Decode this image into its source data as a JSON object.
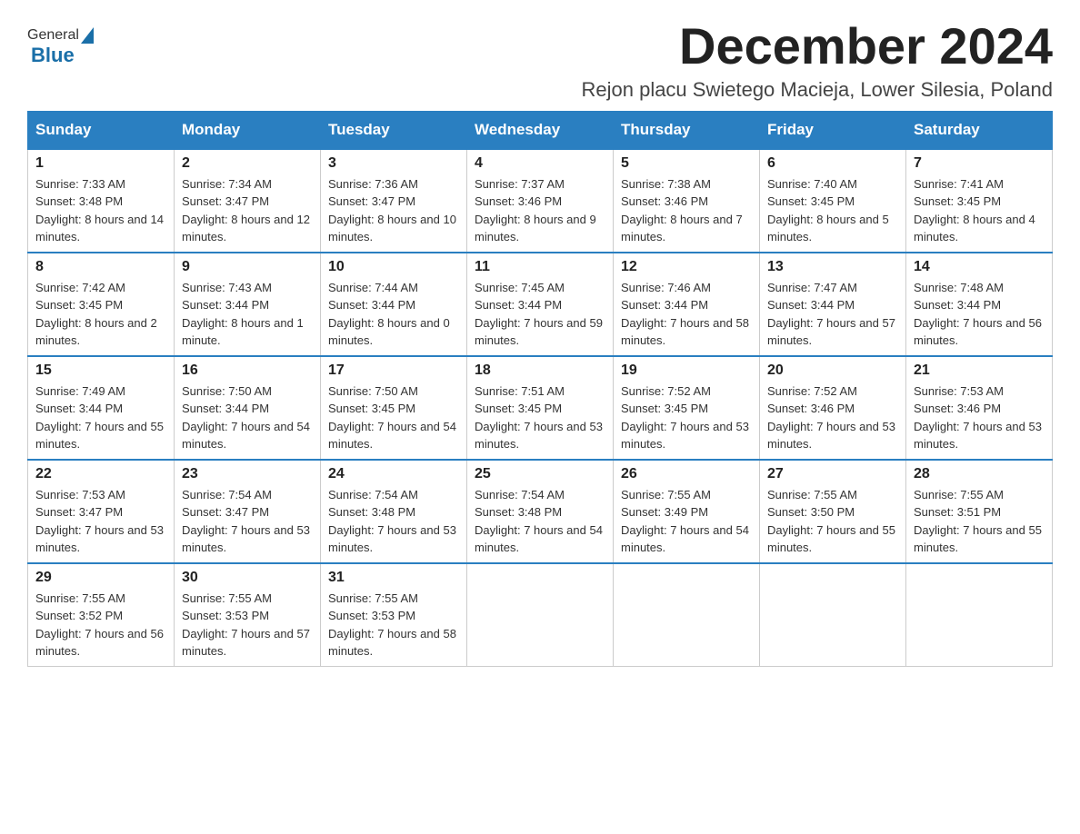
{
  "header": {
    "logo": {
      "general": "General",
      "blue": "Blue"
    },
    "title": "December 2024",
    "location": "Rejon placu Swietego Macieja, Lower Silesia, Poland"
  },
  "days_of_week": [
    "Sunday",
    "Monday",
    "Tuesday",
    "Wednesday",
    "Thursday",
    "Friday",
    "Saturday"
  ],
  "weeks": [
    [
      {
        "day": "1",
        "sunrise": "7:33 AM",
        "sunset": "3:48 PM",
        "daylight": "8 hours and 14 minutes."
      },
      {
        "day": "2",
        "sunrise": "7:34 AM",
        "sunset": "3:47 PM",
        "daylight": "8 hours and 12 minutes."
      },
      {
        "day": "3",
        "sunrise": "7:36 AM",
        "sunset": "3:47 PM",
        "daylight": "8 hours and 10 minutes."
      },
      {
        "day": "4",
        "sunrise": "7:37 AM",
        "sunset": "3:46 PM",
        "daylight": "8 hours and 9 minutes."
      },
      {
        "day": "5",
        "sunrise": "7:38 AM",
        "sunset": "3:46 PM",
        "daylight": "8 hours and 7 minutes."
      },
      {
        "day": "6",
        "sunrise": "7:40 AM",
        "sunset": "3:45 PM",
        "daylight": "8 hours and 5 minutes."
      },
      {
        "day": "7",
        "sunrise": "7:41 AM",
        "sunset": "3:45 PM",
        "daylight": "8 hours and 4 minutes."
      }
    ],
    [
      {
        "day": "8",
        "sunrise": "7:42 AM",
        "sunset": "3:45 PM",
        "daylight": "8 hours and 2 minutes."
      },
      {
        "day": "9",
        "sunrise": "7:43 AM",
        "sunset": "3:44 PM",
        "daylight": "8 hours and 1 minute."
      },
      {
        "day": "10",
        "sunrise": "7:44 AM",
        "sunset": "3:44 PM",
        "daylight": "8 hours and 0 minutes."
      },
      {
        "day": "11",
        "sunrise": "7:45 AM",
        "sunset": "3:44 PM",
        "daylight": "7 hours and 59 minutes."
      },
      {
        "day": "12",
        "sunrise": "7:46 AM",
        "sunset": "3:44 PM",
        "daylight": "7 hours and 58 minutes."
      },
      {
        "day": "13",
        "sunrise": "7:47 AM",
        "sunset": "3:44 PM",
        "daylight": "7 hours and 57 minutes."
      },
      {
        "day": "14",
        "sunrise": "7:48 AM",
        "sunset": "3:44 PM",
        "daylight": "7 hours and 56 minutes."
      }
    ],
    [
      {
        "day": "15",
        "sunrise": "7:49 AM",
        "sunset": "3:44 PM",
        "daylight": "7 hours and 55 minutes."
      },
      {
        "day": "16",
        "sunrise": "7:50 AM",
        "sunset": "3:44 PM",
        "daylight": "7 hours and 54 minutes."
      },
      {
        "day": "17",
        "sunrise": "7:50 AM",
        "sunset": "3:45 PM",
        "daylight": "7 hours and 54 minutes."
      },
      {
        "day": "18",
        "sunrise": "7:51 AM",
        "sunset": "3:45 PM",
        "daylight": "7 hours and 53 minutes."
      },
      {
        "day": "19",
        "sunrise": "7:52 AM",
        "sunset": "3:45 PM",
        "daylight": "7 hours and 53 minutes."
      },
      {
        "day": "20",
        "sunrise": "7:52 AM",
        "sunset": "3:46 PM",
        "daylight": "7 hours and 53 minutes."
      },
      {
        "day": "21",
        "sunrise": "7:53 AM",
        "sunset": "3:46 PM",
        "daylight": "7 hours and 53 minutes."
      }
    ],
    [
      {
        "day": "22",
        "sunrise": "7:53 AM",
        "sunset": "3:47 PM",
        "daylight": "7 hours and 53 minutes."
      },
      {
        "day": "23",
        "sunrise": "7:54 AM",
        "sunset": "3:47 PM",
        "daylight": "7 hours and 53 minutes."
      },
      {
        "day": "24",
        "sunrise": "7:54 AM",
        "sunset": "3:48 PM",
        "daylight": "7 hours and 53 minutes."
      },
      {
        "day": "25",
        "sunrise": "7:54 AM",
        "sunset": "3:48 PM",
        "daylight": "7 hours and 54 minutes."
      },
      {
        "day": "26",
        "sunrise": "7:55 AM",
        "sunset": "3:49 PM",
        "daylight": "7 hours and 54 minutes."
      },
      {
        "day": "27",
        "sunrise": "7:55 AM",
        "sunset": "3:50 PM",
        "daylight": "7 hours and 55 minutes."
      },
      {
        "day": "28",
        "sunrise": "7:55 AM",
        "sunset": "3:51 PM",
        "daylight": "7 hours and 55 minutes."
      }
    ],
    [
      {
        "day": "29",
        "sunrise": "7:55 AM",
        "sunset": "3:52 PM",
        "daylight": "7 hours and 56 minutes."
      },
      {
        "day": "30",
        "sunrise": "7:55 AM",
        "sunset": "3:53 PM",
        "daylight": "7 hours and 57 minutes."
      },
      {
        "day": "31",
        "sunrise": "7:55 AM",
        "sunset": "3:53 PM",
        "daylight": "7 hours and 58 minutes."
      },
      null,
      null,
      null,
      null
    ]
  ],
  "labels": {
    "sunrise": "Sunrise:",
    "sunset": "Sunset:",
    "daylight": "Daylight:"
  }
}
